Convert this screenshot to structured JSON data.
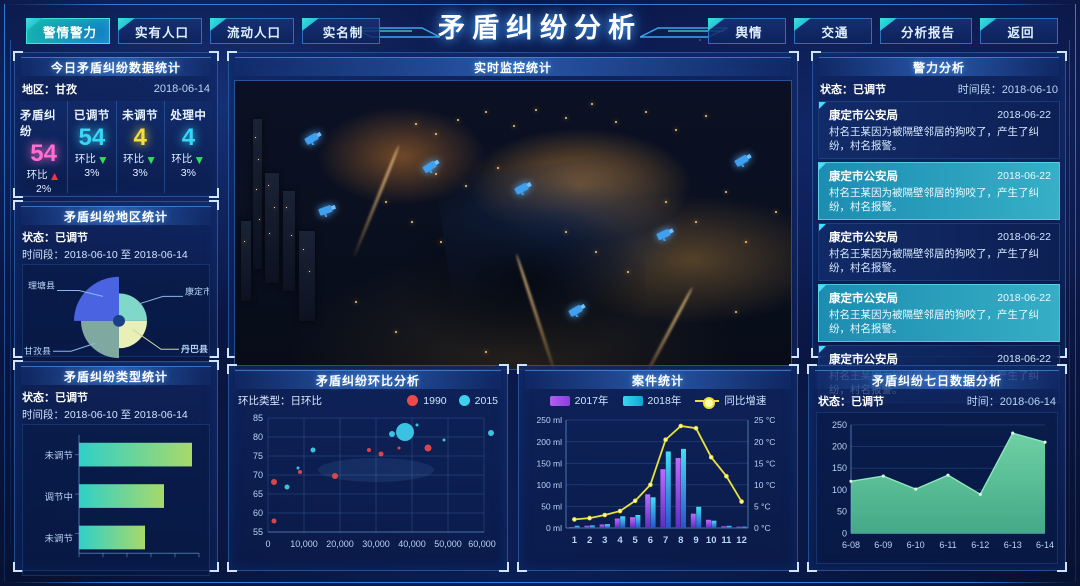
{
  "header": {
    "title": "矛盾纠纷分析",
    "tabs_left": [
      {
        "label": "警情警力",
        "active": true
      },
      {
        "label": "实有人口",
        "active": false
      },
      {
        "label": "流动人口",
        "active": false
      },
      {
        "label": "实名制",
        "active": false
      }
    ],
    "tabs_right": [
      {
        "label": "舆情"
      },
      {
        "label": "交通"
      },
      {
        "label": "分析报告"
      },
      {
        "label": "返回"
      }
    ]
  },
  "stats_panel": {
    "title": "今日矛盾纠纷数据统计",
    "region_label": "地区：甘孜",
    "date": "2018-06-14",
    "cells": [
      {
        "label": "矛盾纠纷",
        "value": "54",
        "color": "#ff6fd0",
        "cmp_label": "环比",
        "dir": "up",
        "pct": "2%"
      },
      {
        "label": "已调节",
        "value": "54",
        "color": "#37d7f5",
        "cmp_label": "环比",
        "dir": "down",
        "pct": "3%"
      },
      {
        "label": "未调节",
        "value": "4",
        "color": "#f5e13c",
        "cmp_label": "环比",
        "dir": "down",
        "pct": "3%"
      },
      {
        "label": "处理中",
        "value": "4",
        "color": "#37d7f5",
        "cmp_label": "环比",
        "dir": "down",
        "pct": "3%"
      }
    ]
  },
  "region_panel": {
    "title": "矛盾纠纷地区统计",
    "status_label": "状态：已调节",
    "period_label": "时间段：2018-06-10 至 2018-06-14",
    "chart_data": {
      "type": "pie",
      "title": "矛盾纠纷地区统计",
      "labels": [
        "理塘县",
        "康定市",
        "丹巴县",
        "甘孜县"
      ],
      "values": [
        38,
        16,
        12,
        34
      ],
      "colors": [
        "#4a63e0",
        "#7fd8c9",
        "#e8f0b8",
        "#7fa8a0"
      ],
      "legend": "callout labels around donut"
    }
  },
  "type_panel": {
    "title": "矛盾纠纷类型统计",
    "status_label": "状态：已调节",
    "period_label": "时间段：2018-06-10 至 2018-06-14",
    "chart_data": {
      "type": "bar",
      "orientation": "horizontal",
      "title": "矛盾纠纷类型统计",
      "categories": [
        "未调节",
        "调节中",
        "未调节"
      ],
      "values": [
        96,
        72,
        56
      ],
      "xlabel": "",
      "ylabel": "",
      "xlim": [
        0,
        110
      ],
      "grid": false,
      "colors": [
        "#2fd0c8",
        "#a8d96a"
      ]
    }
  },
  "video_panel": {
    "title": "实时监控统计",
    "camera_count": 7,
    "camera_icon": "cctv-camera-icon"
  },
  "alerts_panel": {
    "title": "警力分析",
    "status_label": "状态：已调节",
    "period_label": "时间段：2018-06-10",
    "items": [
      {
        "org": "康定市公安局",
        "date": "2018-06-22",
        "text": "村名王某因为被隔壁邻居的狗咬了，产生了纠纷，村名报警。",
        "highlight": false
      },
      {
        "org": "康定市公安局",
        "date": "2018-06-22",
        "text": "村名王某因为被隔壁邻居的狗咬了，产生了纠纷，村名报警。",
        "highlight": true
      },
      {
        "org": "康定市公安局",
        "date": "2018-06-22",
        "text": "村名王某因为被隔壁邻居的狗咬了，产生了纠纷，村名报警。",
        "highlight": false
      },
      {
        "org": "康定市公安局",
        "date": "2018-06-22",
        "text": "村名王某因为被隔壁邻居的狗咬了，产生了纠纷，村名报警。",
        "highlight": true
      },
      {
        "org": "康定市公安局",
        "date": "2018-06-22",
        "text": "村名王某因为被隔壁邻居的狗咬了，产生了纠纷，村名报警。",
        "highlight": false
      }
    ]
  },
  "scatter_panel": {
    "title": "矛盾纠纷环比分析",
    "type_label": "环比类型：日环比",
    "chart_data": {
      "type": "scatter",
      "title": "矛盾纠纷环比分析",
      "xlabel": "",
      "ylabel": "",
      "xlim": [
        0,
        65000
      ],
      "ylim": [
        55,
        85
      ],
      "xticks": [
        "0",
        "10,000",
        "20,000",
        "30,000",
        "40,000",
        "50,000",
        "60,000"
      ],
      "yticks": [
        "55",
        "60",
        "65",
        "70",
        "75",
        "80",
        "85"
      ],
      "grid": true,
      "legend": [
        "1990",
        "2015"
      ],
      "legend_position": "top-right",
      "series": [
        {
          "name": "1990",
          "color": "#ef4a4a",
          "points": [
            {
              "x": 1800,
              "y": 68.0,
              "r": 3
            },
            {
              "x": 1600,
              "y": 57.8,
              "r": 2.5
            },
            {
              "x": 9000,
              "y": 70.8,
              "r": 2
            },
            {
              "x": 18500,
              "y": 69.6,
              "r": 3
            },
            {
              "x": 31500,
              "y": 75.4,
              "r": 2.5
            },
            {
              "x": 28000,
              "y": 76.6,
              "r": 2
            },
            {
              "x": 44500,
              "y": 76.9,
              "r": 3.5
            },
            {
              "x": 36500,
              "y": 77.0,
              "r": 1.5
            }
          ]
        },
        {
          "name": "2015",
          "color": "#3fd0ee",
          "points": [
            {
              "x": 5200,
              "y": 66.8,
              "r": 2.5
            },
            {
              "x": 12500,
              "y": 77.0,
              "r": 2.5
            },
            {
              "x": 34500,
              "y": 80.7,
              "r": 3
            },
            {
              "x": 38000,
              "y": 81.3,
              "r": 9
            },
            {
              "x": 41500,
              "y": 83.2,
              "r": 1.5
            },
            {
              "x": 49000,
              "y": 79.2,
              "r": 1.5
            },
            {
              "x": 62000,
              "y": 81.6,
              "r": 3
            },
            {
              "x": 8500,
              "y": 71.4,
              "r": 1.5
            }
          ]
        }
      ]
    }
  },
  "case_panel": {
    "title": "案件统计",
    "chart_data": {
      "type": "bar",
      "title": "案件统计",
      "categories": [
        "1",
        "2",
        "3",
        "4",
        "5",
        "6",
        "7",
        "8",
        "9",
        "10",
        "11",
        "12"
      ],
      "ylabel": "ml",
      "ylim": [
        0,
        250
      ],
      "yticks": [
        "0 ml",
        "50 ml",
        "100 ml",
        "150 ml",
        "200 ml",
        "250 ml"
      ],
      "y2label": "°C",
      "y2lim": [
        0,
        25
      ],
      "y2ticks": [
        "0 °C",
        "5 °C",
        "10 °C",
        "15 °C",
        "20 °C",
        "25 °C"
      ],
      "series": [
        {
          "name": "2017年",
          "type": "bar",
          "color": "#9a4ae8",
          "values": [
            2,
            5,
            8,
            22,
            25,
            78,
            136,
            162,
            33,
            19,
            4,
            3
          ]
        },
        {
          "name": "2018年",
          "type": "bar",
          "color": "#1fc4e0",
          "values": [
            3,
            6,
            9,
            27,
            30,
            71,
            177,
            183,
            49,
            17,
            5,
            3
          ]
        },
        {
          "name": "同比增速",
          "type": "line",
          "color": "#e8e23c",
          "values": [
            2.0,
            2.3,
            3.0,
            3.9,
            6.3,
            10.0,
            20.4,
            23.6,
            23.1,
            16.4,
            12.0,
            6.1
          ]
        }
      ],
      "legend_position": "top-center"
    }
  },
  "seven_day_panel": {
    "title": "矛盾纠纷七日数据分析",
    "status_label": "状态：已调节",
    "time_label": "时间：2018-06-14",
    "chart_data": {
      "type": "area",
      "title": "矛盾纠纷七日数据分析",
      "categories": [
        "6-08",
        "6-09",
        "6-10",
        "6-11",
        "6-12",
        "6-13",
        "6-14"
      ],
      "values": [
        120,
        132,
        102,
        134,
        90,
        231,
        210
      ],
      "ylim": [
        0,
        250
      ],
      "yticks": [
        "0",
        "50",
        "100",
        "150",
        "200",
        "250"
      ],
      "color": "#5fd3a0",
      "grid": true
    }
  }
}
